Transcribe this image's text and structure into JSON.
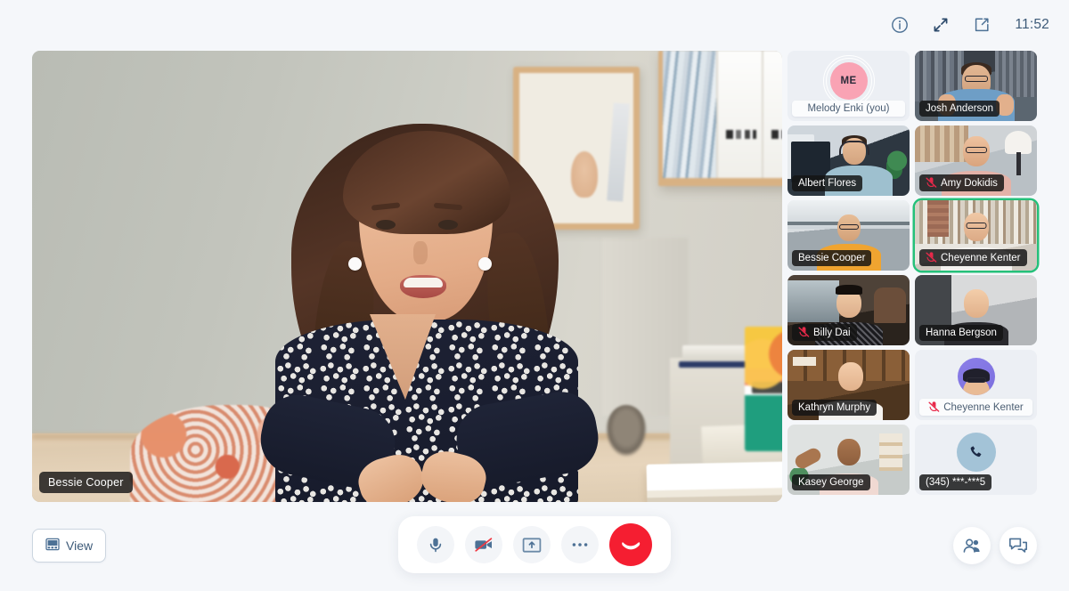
{
  "topbar": {
    "info_icon": "info-circle-icon",
    "collapse_icon": "collapse-arrows-icon",
    "popout_icon": "external-link-icon",
    "time": "11:52"
  },
  "stage": {
    "speaker_name": "Bessie Cooper"
  },
  "participants": [
    {
      "name": "Melody Enki (you)",
      "type": "self",
      "initials": "ME",
      "muted": false,
      "active": false,
      "avatar_color": "#f9a3b4"
    },
    {
      "name": "Josh Anderson",
      "type": "video",
      "photo": "p-josh",
      "muted": false,
      "active": false
    },
    {
      "name": "Albert Flores",
      "type": "video",
      "photo": "p-albert",
      "muted": false,
      "active": false
    },
    {
      "name": "Amy Dokidis",
      "type": "video",
      "photo": "p-amy",
      "muted": true,
      "active": false
    },
    {
      "name": "Bessie Cooper",
      "type": "video",
      "photo": "p-bessie",
      "muted": false,
      "active": false
    },
    {
      "name": "Cheyenne Kenter",
      "type": "video",
      "photo": "p-cheyenne",
      "muted": true,
      "active": true
    },
    {
      "name": "Billy Dai",
      "type": "video",
      "photo": "p-billy",
      "muted": true,
      "active": false
    },
    {
      "name": "Hanna Bergson",
      "type": "video",
      "photo": "p-hanna",
      "muted": false,
      "active": false
    },
    {
      "name": "Kathryn Murphy",
      "type": "video",
      "photo": "p-kathryn",
      "muted": false,
      "active": false
    },
    {
      "name": "Cheyenne Kenter",
      "type": "avatar",
      "muted": true,
      "active": false,
      "avatar_color": "#7b6ede"
    },
    {
      "name": "Kasey George",
      "type": "video",
      "photo": "p-kasey",
      "muted": false,
      "active": false
    },
    {
      "name": "(345) ***-***5",
      "type": "phone",
      "muted": false,
      "active": false,
      "avatar_color": "#a3c3d7"
    }
  ],
  "controls": {
    "view_label": "View",
    "view_icon": "layout-grid-icon",
    "mic_icon": "microphone-icon",
    "camera_icon": "camera-off-icon",
    "share_icon": "screen-share-icon",
    "more_icon": "more-options-icon",
    "end_call_icon": "hang-up-icon",
    "participants_icon": "people-icon",
    "chat_icon": "chat-bubbles-icon"
  },
  "colors": {
    "page_bg": "#f5f7fa",
    "accent": "#4d7195",
    "end_call": "#f51e31",
    "active_speaker": "#25c07a",
    "mute": "#e8294a"
  }
}
